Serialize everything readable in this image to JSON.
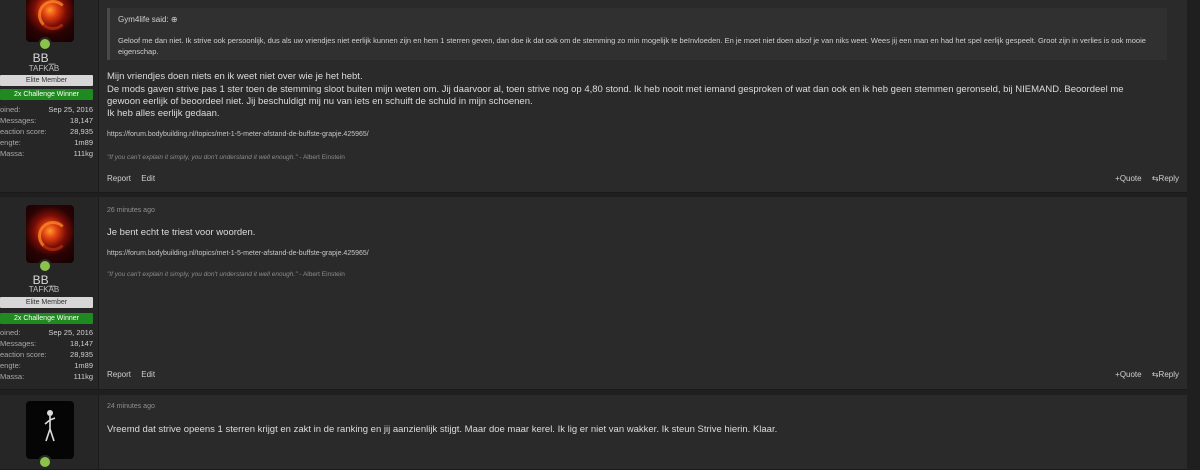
{
  "posts": [
    {
      "user": {
        "name": "BB_",
        "title": "TAFKAB",
        "banner_elite": "Elite Member",
        "banner_challenge": "2x Challenge Winner",
        "stats": [
          {
            "k": "oined:",
            "v": "Sep 25, 2016"
          },
          {
            "k": "Messages:",
            "v": "18,147"
          },
          {
            "k": "eaction score:",
            "v": "28,935"
          },
          {
            "k": "engte:",
            "v": "1m89"
          },
          {
            "k": "Massa:",
            "v": "111kg"
          }
        ]
      },
      "quote": {
        "author": "Gym4life said: ⊕",
        "body": "Geloof me dan niet. Ik strive ook persoonlijk, dus als uw vriendjes niet eerlijk kunnen zijn en hem 1 sterren geven, dan doe ik dat ook om de stemming zo min mogelijk te beïnvloeden. En je moet niet doen alsof je van niks weet. Wees jij een man en had het spel eerlijk gespeelt. Groot zijn in verlies is ook mooie eigenschap."
      },
      "message": [
        "Mijn vriendjes doen niets en ik weet niet over wie je het hebt.",
        "De mods gaven strive pas 1 ster toen de stemming sloot buiten mijn weten om. Jij daarvoor al, toen strive nog op 4,80 stond. Ik heb nooit met iemand gesproken of wat dan ook en ik heb geen stemmen geronseld, bij NIEMAND. Beoordeel me",
        "gewoon eerlijk of beoordeel niet. Jij beschuldigt mij nu van iets en schuift de schuld in mijn schoenen.",
        "Ik heb alles eerlijk gedaan."
      ],
      "link": "https://forum.bodybuilding.nl/topics/met-1-5-meter-afstand-de-buffste-grapje.425965/",
      "signature": {
        "quote": "\"If you can't explain it simply, you don't understand it well enough.\"",
        "author": " - Albert Einstein"
      },
      "actions": {
        "report": "Report",
        "edit": "Edit",
        "quote": "+Quote",
        "reply": "⇆Reply"
      }
    },
    {
      "time": "26 minutes ago",
      "user": {
        "name": "BB_",
        "title": "TAFKAB",
        "banner_elite": "Elite Member",
        "banner_challenge": "2x Challenge Winner",
        "stats": [
          {
            "k": "oined:",
            "v": "Sep 25, 2016"
          },
          {
            "k": "Messages:",
            "v": "18,147"
          },
          {
            "k": "eaction score:",
            "v": "28,935"
          },
          {
            "k": "engte:",
            "v": "1m89"
          },
          {
            "k": "Massa:",
            "v": "111kg"
          }
        ]
      },
      "message": [
        "Je bent echt te triest voor woorden."
      ],
      "link": "https://forum.bodybuilding.nl/topics/met-1-5-meter-afstand-de-buffste-grapje.425965/",
      "signature": {
        "quote": "\"If you can't explain it simply, you don't understand it well enough.\"",
        "author": " - Albert Einstein"
      },
      "actions": {
        "report": "Report",
        "edit": "Edit",
        "quote": "+Quote",
        "reply": "⇆Reply"
      }
    },
    {
      "time": "24 minutes ago",
      "message": [
        "Vreemd dat strive opeens 1 sterren krijgt en zakt in de ranking en jij aanzienlijk stijgt. Maar doe maar kerel. Ik lig er niet van wakker. Ik steun Strive hierin. Klaar."
      ]
    }
  ]
}
